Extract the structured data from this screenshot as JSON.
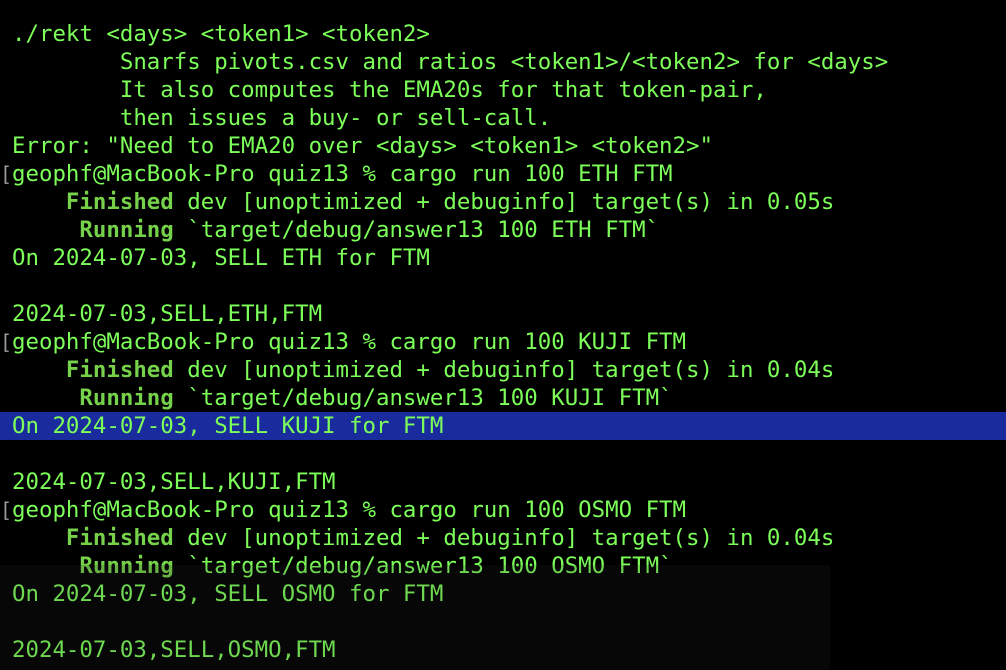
{
  "terminal": {
    "colors": {
      "background": "#000000",
      "text": "#7dff5a",
      "highlight": "#1a2b9e"
    },
    "usage": {
      "command": "./rekt <days> <token1> <token2>",
      "desc1": "        Snarfs pivots.csv and ratios <token1>/<token2> for <days>",
      "desc2": "        It also computes the EMA20s for that token-pair,",
      "desc3": "        then issues a buy- or sell-call.",
      "error": "Error: \"Need to EMA20 over <days> <token1> <token2>\""
    },
    "runs": [
      {
        "bracket": "[",
        "prompt": "geophf@MacBook-Pro quiz13 % cargo run 100 ETH FTM",
        "finished_label": "    Finished",
        "finished_rest": " dev [unoptimized + debuginfo] target(s) in 0.05s",
        "running_label": "     Running",
        "running_rest": " `target/debug/answer13 100 ETH FTM`",
        "result": "On 2024-07-03, SELL ETH for FTM",
        "csv": "2024-07-03,SELL,ETH,FTM"
      },
      {
        "bracket": "[",
        "prompt": "geophf@MacBook-Pro quiz13 % cargo run 100 KUJI FTM",
        "finished_label": "    Finished",
        "finished_rest": " dev [unoptimized + debuginfo] target(s) in 0.04s",
        "running_label": "     Running",
        "running_rest": " `target/debug/answer13 100 KUJI FTM`",
        "result": "On 2024-07-03, SELL KUJI for FTM",
        "csv": "2024-07-03,SELL,KUJI,FTM"
      },
      {
        "bracket": "[",
        "prompt": "geophf@MacBook-Pro quiz13 % cargo run 100 OSMO FTM",
        "finished_label": "    Finished",
        "finished_rest": " dev [unoptimized + debuginfo] target(s) in 0.04s",
        "running_label": "     Running",
        "running_rest": " `target/debug/answer13 100 OSMO FTM`",
        "result": "On 2024-07-03, SELL OSMO for FTM",
        "csv": "2024-07-03,SELL,OSMO,FTM"
      }
    ]
  }
}
